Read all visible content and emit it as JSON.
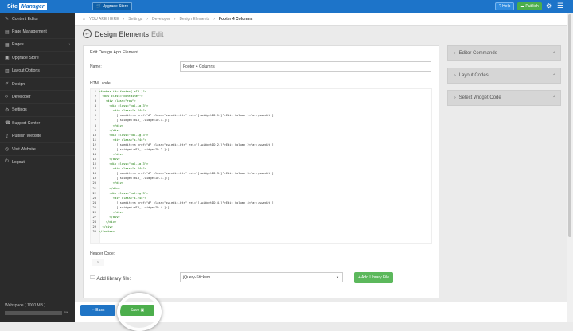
{
  "topbar": {
    "logo_a": "Site",
    "logo_b": "Manager",
    "upgrade": "Upgrade Store",
    "help": "Help",
    "publish": "Publish"
  },
  "sidebar": {
    "items": [
      {
        "label": "Content Editor",
        "icon": "pencil-icon"
      },
      {
        "label": "Page Management",
        "icon": "file-icon"
      },
      {
        "label": "Pages",
        "icon": "pages-icon",
        "expand": "›"
      },
      {
        "label": "Upgrade Store",
        "icon": "store-icon"
      },
      {
        "label": "Layout Options",
        "icon": "layout-icon"
      },
      {
        "label": "Design",
        "icon": "brush-icon"
      },
      {
        "label": "Developer",
        "icon": "code-icon"
      },
      {
        "label": "Settings",
        "icon": "gear-icon"
      },
      {
        "label": "Support Center",
        "icon": "support-icon"
      },
      {
        "label": "Publish Website",
        "icon": "upload-icon"
      },
      {
        "label": "Visit Website",
        "icon": "globe-icon"
      },
      {
        "label": "Logout",
        "icon": "power-icon"
      }
    ],
    "webspace": "Webspace ( 1000 MB )",
    "webspace_pct": "0%",
    "webspace_used": 0
  },
  "breadcrumb": {
    "items": [
      "YOU ARE HERE",
      "Settings",
      "Developer",
      "Design Elements",
      "Footer 4 Columns"
    ]
  },
  "page": {
    "title": "Design Elements",
    "title_edit": "Edit"
  },
  "form": {
    "panel_title": "Edit Design App Element",
    "name_label": "Name:",
    "name_value": "Footer 4 Columns",
    "html_label": "HTML code:",
    "header_label": "Header Code:",
    "header_line": "1",
    "library_label": "Add library file:",
    "library_value": "jQuery-Stickem",
    "add_library": "+ Add Library File"
  },
  "code_lines": [
    "<footer id=\"footer[-eID-]\">",
    "  <div class=\"container\">",
    "    <div class=\"row\">",
    "      <div class=\"col-lg-3\">",
    "        <div class=\"s-f4c\">",
    "          [-swedit:<a href=\"#\" class=\"sw-edit-btn\" rel=\"[-widgetID-1-]\">Edit Column 1</a>:/swedit:]",
    "          [-swidget:WID_[-widgetID-1-]:]",
    "        </div>",
    "      </div>",
    "      <div class=\"col-lg-3\">",
    "        <div class=\"s-f4c\">",
    "          [-swedit:<a href=\"#\" class=\"sw-edit-btn\" rel=\"[-widgetID-2-]\">Edit Column 2</a>:/swedit:]",
    "          [-swidget:WID_[-widgetID-2-]:]",
    "        </div>",
    "      </div>",
    "      <div class=\"col-lg-3\">",
    "        <div class=\"s-f4c\">",
    "          [-swedit:<a href=\"#\" class=\"sw-edit-btn\" rel=\"[-widgetID-3-]\">Edit Column 3</a>:/swedit:]",
    "          [-swidget:WID_[-widgetID-3-]:]",
    "        </div>",
    "      </div>",
    "      <div class=\"col-lg-3\">",
    "        <div class=\"s-f4c\">",
    "          [-swedit:<a href=\"#\" class=\"sw-edit-btn\" rel=\"[-widgetID-4-]\">Edit Column 4</a>:/swedit:]",
    "          [-swidget:WID_[-widgetID-4-]:]",
    "        </div>",
    "      </div>",
    "    </div>",
    "  </div>",
    "</footer>"
  ],
  "right_panels": [
    "Editor Commands",
    "Layout Codes",
    "Select Widget Code"
  ],
  "footer": {
    "back": "Back",
    "save": "Save"
  }
}
